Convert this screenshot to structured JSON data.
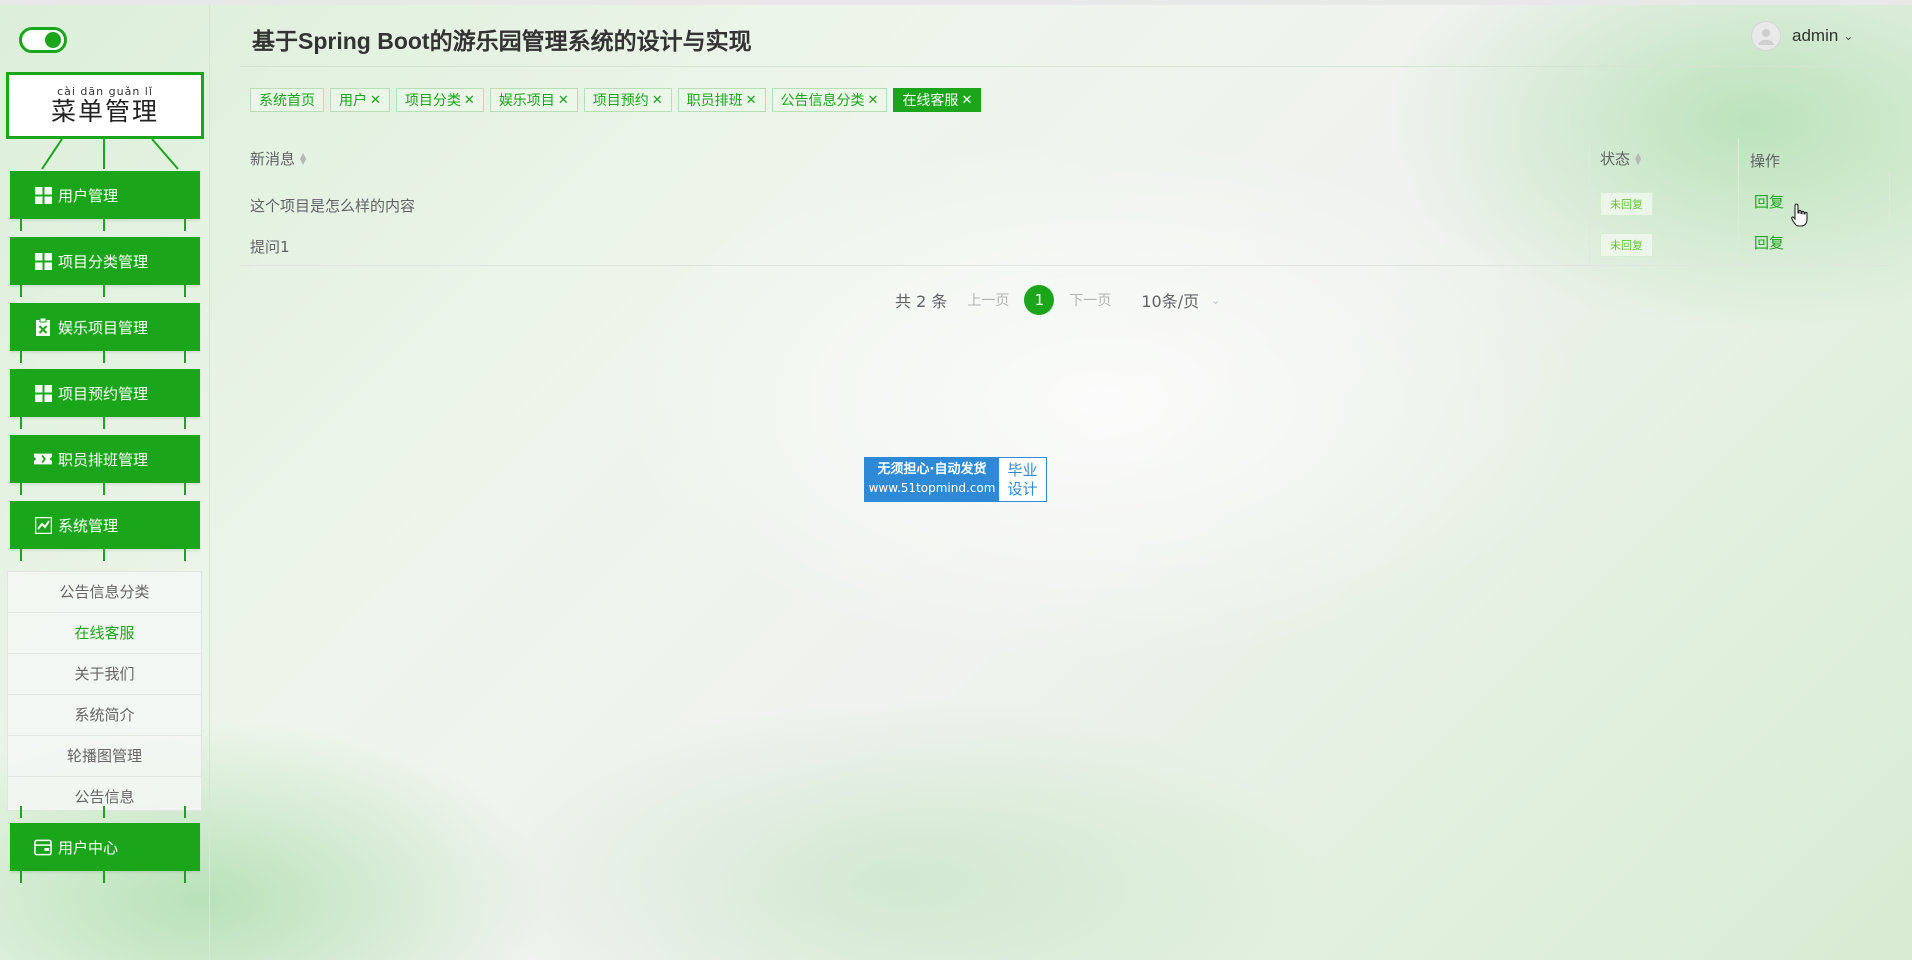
{
  "app": {
    "title": "基于Spring Boot的游乐园管理系统的设计与实现"
  },
  "header": {
    "username": "admin",
    "caret": "⌄"
  },
  "sidebar": {
    "menu_title_pinyin": "cài dān guǎn lǐ",
    "menu_title": "菜单管理",
    "items": [
      {
        "label": "用户管理",
        "icon": "grid-icon"
      },
      {
        "label": "项目分类管理",
        "icon": "grid-icon"
      },
      {
        "label": "娱乐项目管理",
        "icon": "clipboard-icon"
      },
      {
        "label": "项目预约管理",
        "icon": "grid-icon"
      },
      {
        "label": "职员排班管理",
        "icon": "ticket-icon"
      },
      {
        "label": "系统管理",
        "icon": "chart-icon"
      },
      {
        "label": "用户中心",
        "icon": "wallet-icon"
      }
    ],
    "submenu": [
      {
        "label": "公告信息分类"
      },
      {
        "label": "在线客服"
      },
      {
        "label": "关于我们"
      },
      {
        "label": "系统简介"
      },
      {
        "label": "轮播图管理"
      },
      {
        "label": "公告信息"
      }
    ]
  },
  "tabs": [
    {
      "label": "系统首页"
    },
    {
      "label": "用户"
    },
    {
      "label": "项目分类"
    },
    {
      "label": "娱乐项目"
    },
    {
      "label": "项目预约"
    },
    {
      "label": "职员排班"
    },
    {
      "label": "公告信息分类"
    },
    {
      "label": "在线客服"
    }
  ],
  "tab_close": "✕",
  "table": {
    "columns": {
      "message": "新消息",
      "status": "状态",
      "actions": "操作"
    },
    "rows": [
      {
        "message": "这个项目是怎么样的内容",
        "status": "未回复",
        "action": "回复"
      },
      {
        "message": "提问1",
        "status": "未回复",
        "action": "回复"
      }
    ]
  },
  "pagination": {
    "total": "共 2 条",
    "prev": "上一页",
    "current": "1",
    "next": "下一页",
    "page_size": "10条/页"
  },
  "watermark": {
    "line1": "无须担心·自动发货",
    "line2": "www.51topmind.com",
    "right_top": "毕业",
    "right_bottom": "设计"
  },
  "colors": {
    "accent": "#1aa51a",
    "status_text": "#67c23a",
    "watermark_blue": "#2e8ad6"
  }
}
